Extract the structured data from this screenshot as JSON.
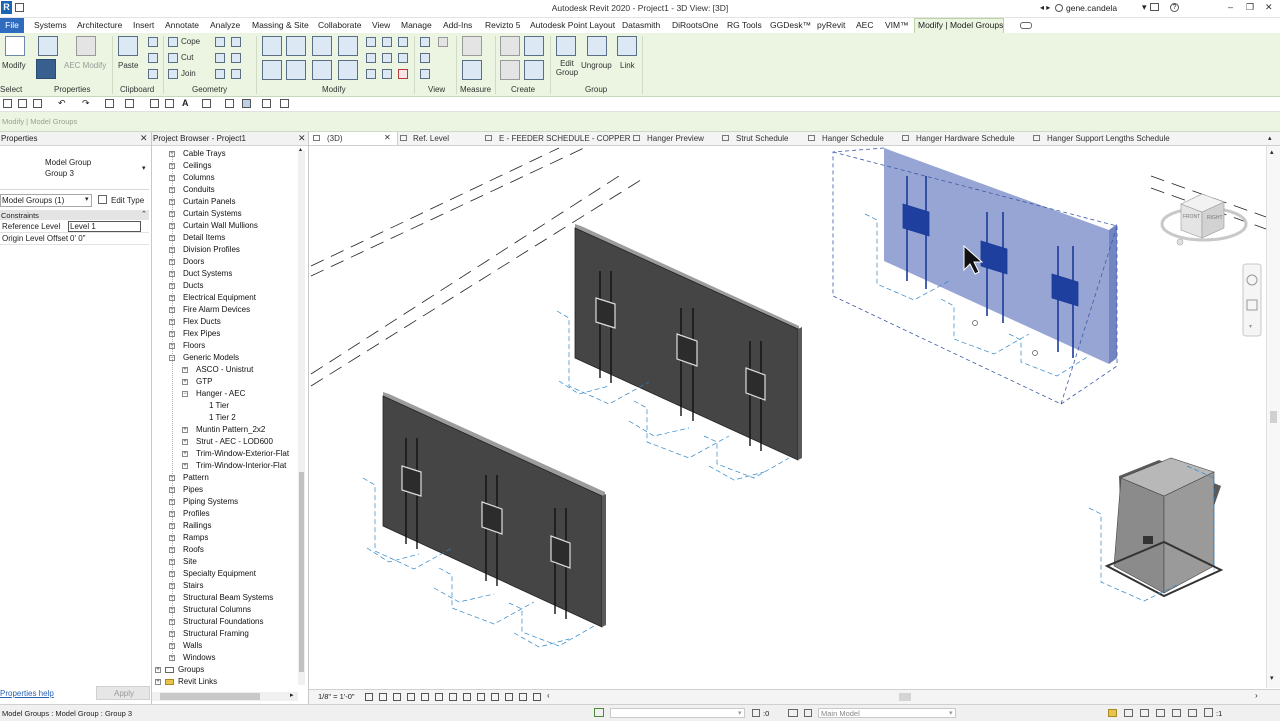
{
  "app": {
    "title": "Autodesk Revit 2020 - Project1 - 3D View: [3D]",
    "logo": "R",
    "user": "gene.candela",
    "window_buttons": [
      "–",
      "❐",
      "✕"
    ]
  },
  "ribbon_tabs": [
    {
      "label": "File"
    },
    {
      "label": "Systems"
    },
    {
      "label": "Architecture"
    },
    {
      "label": "Insert"
    },
    {
      "label": "Annotate"
    },
    {
      "label": "Analyze"
    },
    {
      "label": "Massing & Site"
    },
    {
      "label": "Collaborate"
    },
    {
      "label": "View"
    },
    {
      "label": "Manage"
    },
    {
      "label": "Add-Ins"
    },
    {
      "label": "Revizto 5"
    },
    {
      "label": "Autodesk Point Layout"
    },
    {
      "label": "Datasmith"
    },
    {
      "label": "DiRootsOne"
    },
    {
      "label": "RG Tools"
    },
    {
      "label": "GGDesk™"
    },
    {
      "label": "pyRevit"
    },
    {
      "label": "AEC"
    },
    {
      "label": "VIM™"
    },
    {
      "label": "Modify | Model Groups"
    }
  ],
  "ribbon": {
    "modify": "Modify",
    "aec_modify": "AEC Modify",
    "paste": "Paste",
    "cope": "Cope",
    "cut": "Cut",
    "join": "Join",
    "edit_group": "Edit Group",
    "ungroup": "Ungroup",
    "link": "Link",
    "panels": {
      "select": "Select",
      "properties": "Properties",
      "clipboard": "Clipboard",
      "geometry": "Geometry",
      "modify": "Modify",
      "view": "View",
      "measure": "Measure",
      "create": "Create",
      "group": "Group"
    }
  },
  "options_bar": "Modify | Model Groups",
  "properties": {
    "header": "Properties",
    "type_line1": "Model Group",
    "type_line2": "Group 3",
    "selector": "Model Groups (1)",
    "edit_type": "Edit Type",
    "section": "Constraints",
    "rows": [
      {
        "label": "Reference Level",
        "value": "Level 1"
      },
      {
        "label": "Origin Level Offset",
        "value": "0'  0\""
      }
    ],
    "help": "Properties help",
    "apply": "Apply"
  },
  "project_browser": {
    "header": "Project Browser - Project1",
    "items": [
      {
        "label": "Cable Trays",
        "toggle": "+"
      },
      {
        "label": "Ceilings",
        "toggle": "+"
      },
      {
        "label": "Columns",
        "toggle": "+"
      },
      {
        "label": "Conduits",
        "toggle": "+"
      },
      {
        "label": "Curtain Panels",
        "toggle": "+"
      },
      {
        "label": "Curtain Systems",
        "toggle": "+"
      },
      {
        "label": "Curtain Wall Mullions",
        "toggle": "+"
      },
      {
        "label": "Detail Items",
        "toggle": "+"
      },
      {
        "label": "Division Profiles",
        "toggle": "+"
      },
      {
        "label": "Doors",
        "toggle": "+"
      },
      {
        "label": "Duct Systems",
        "toggle": "+"
      },
      {
        "label": "Ducts",
        "toggle": "+"
      },
      {
        "label": "Electrical Equipment",
        "toggle": "+"
      },
      {
        "label": "Fire Alarm Devices",
        "toggle": "+"
      },
      {
        "label": "Flex Ducts",
        "toggle": "+"
      },
      {
        "label": "Flex Pipes",
        "toggle": "+"
      },
      {
        "label": "Floors",
        "toggle": "+"
      },
      {
        "label": "Generic Models",
        "toggle": "−"
      },
      {
        "label": "ASCO - Unistrut",
        "toggle": "+"
      },
      {
        "label": "GTP",
        "toggle": "+"
      },
      {
        "label": "Hanger - AEC",
        "toggle": "−"
      },
      {
        "label": "1 Tier",
        "toggle": ""
      },
      {
        "label": "1 Tier 2",
        "toggle": ""
      },
      {
        "label": "Muntin Pattern_2x2",
        "toggle": "+"
      },
      {
        "label": "Strut - AEC - LOD600",
        "toggle": "+"
      },
      {
        "label": "Trim-Window-Exterior-Flat",
        "toggle": "+"
      },
      {
        "label": "Trim-Window-Interior-Flat",
        "toggle": "+"
      },
      {
        "label": "Pattern",
        "toggle": "+"
      },
      {
        "label": "Pipes",
        "toggle": "+"
      },
      {
        "label": "Piping Systems",
        "toggle": "+"
      },
      {
        "label": "Profiles",
        "toggle": "+"
      },
      {
        "label": "Railings",
        "toggle": "+"
      },
      {
        "label": "Ramps",
        "toggle": "+"
      },
      {
        "label": "Roofs",
        "toggle": "+"
      },
      {
        "label": "Site",
        "toggle": "+"
      },
      {
        "label": "Specialty Equipment",
        "toggle": "+"
      },
      {
        "label": "Stairs",
        "toggle": "+"
      },
      {
        "label": "Structural Beam Systems",
        "toggle": "+"
      },
      {
        "label": "Structural Columns",
        "toggle": "+"
      },
      {
        "label": "Structural Foundations",
        "toggle": "+"
      },
      {
        "label": "Structural Framing",
        "toggle": "+"
      },
      {
        "label": "Walls",
        "toggle": "+"
      },
      {
        "label": "Windows",
        "toggle": "+"
      },
      {
        "label": "Groups",
        "toggle": "+"
      },
      {
        "label": "Revit Links",
        "toggle": "+"
      }
    ]
  },
  "view_tabs": [
    {
      "label": "(3D)",
      "icon": "3d-view-icon"
    },
    {
      "label": "Ref. Level",
      "icon": "plan-view-icon"
    },
    {
      "label": "E - FEEDER SCHEDULE - COPPER",
      "icon": "schedule-icon"
    },
    {
      "label": "Hanger Preview",
      "icon": "3d-view-icon"
    },
    {
      "label": "Strut Schedule",
      "icon": "schedule-icon"
    },
    {
      "label": "Hanger Schedule",
      "icon": "schedule-icon"
    },
    {
      "label": "Hanger Hardware Schedule",
      "icon": "schedule-icon"
    },
    {
      "label": "Hanger Support Lengths Schedule",
      "icon": "schedule-icon"
    }
  ],
  "viewcube": {
    "front": "FRONT",
    "right": "RIGHT"
  },
  "view_control": {
    "scale": "1/8\" = 1'-0\""
  },
  "status": {
    "message": "Model Groups : Model Group : Group 3",
    "worksets": ":0",
    "design_option": "Main Model",
    "filter_count": ":1"
  }
}
